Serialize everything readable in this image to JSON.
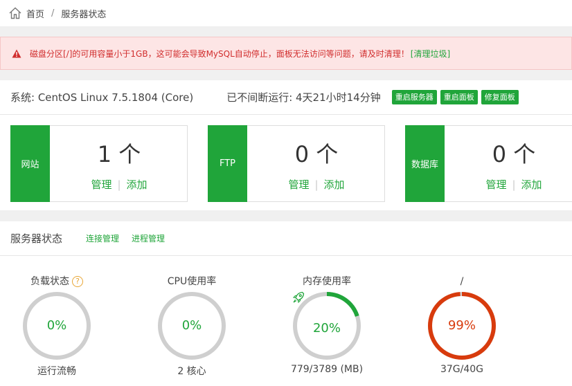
{
  "breadcrumb": {
    "home": "首页",
    "separator": "/",
    "current": "服务器状态"
  },
  "alert": {
    "message": "磁盘分区[/]的可用容量小于1GB，这可能会导致MySQL自动停止，面板无法访问等问题，请及时清理！",
    "link": "[清理垃圾]"
  },
  "system": {
    "os": "系统: CentOS Linux 7.5.1804 (Core)",
    "uptime": "已不间断运行: 4天21小时14分钟",
    "buttons": [
      "重启服务器",
      "重启面板",
      "修复面板"
    ]
  },
  "cards": [
    {
      "label": "网站",
      "count": "1 个",
      "manage": "管理",
      "add": "添加"
    },
    {
      "label": "FTP",
      "count": "0 个",
      "manage": "管理",
      "add": "添加"
    },
    {
      "label": "数据库",
      "count": "0 个",
      "manage": "管理",
      "add": "添加"
    }
  ],
  "status": {
    "title": "服务器状态",
    "links": [
      "连接管理",
      "进程管理"
    ],
    "gauges": [
      {
        "title": "负载状态",
        "help": "?",
        "percent": "0%",
        "value": 0,
        "sub": "运行流畅",
        "color": "#20a53a",
        "text_color": "#20a53a"
      },
      {
        "title": "CPU使用率",
        "percent": "0%",
        "value": 0,
        "sub": "2 核心",
        "color": "#20a53a",
        "text_color": "#20a53a"
      },
      {
        "title": "内存使用率",
        "percent": "20%",
        "value": 20,
        "sub": "779/3789 (MB)",
        "color": "#20a53a",
        "text_color": "#20a53a"
      },
      {
        "title": "/",
        "percent": "99%",
        "value": 99,
        "sub": "37G/40G",
        "color": "#d83b0d",
        "text_color": "#d83b0d"
      }
    ]
  },
  "colors": {
    "accent": "#20a53a",
    "danger": "#d83b0d",
    "track": "#cfcfcf"
  }
}
